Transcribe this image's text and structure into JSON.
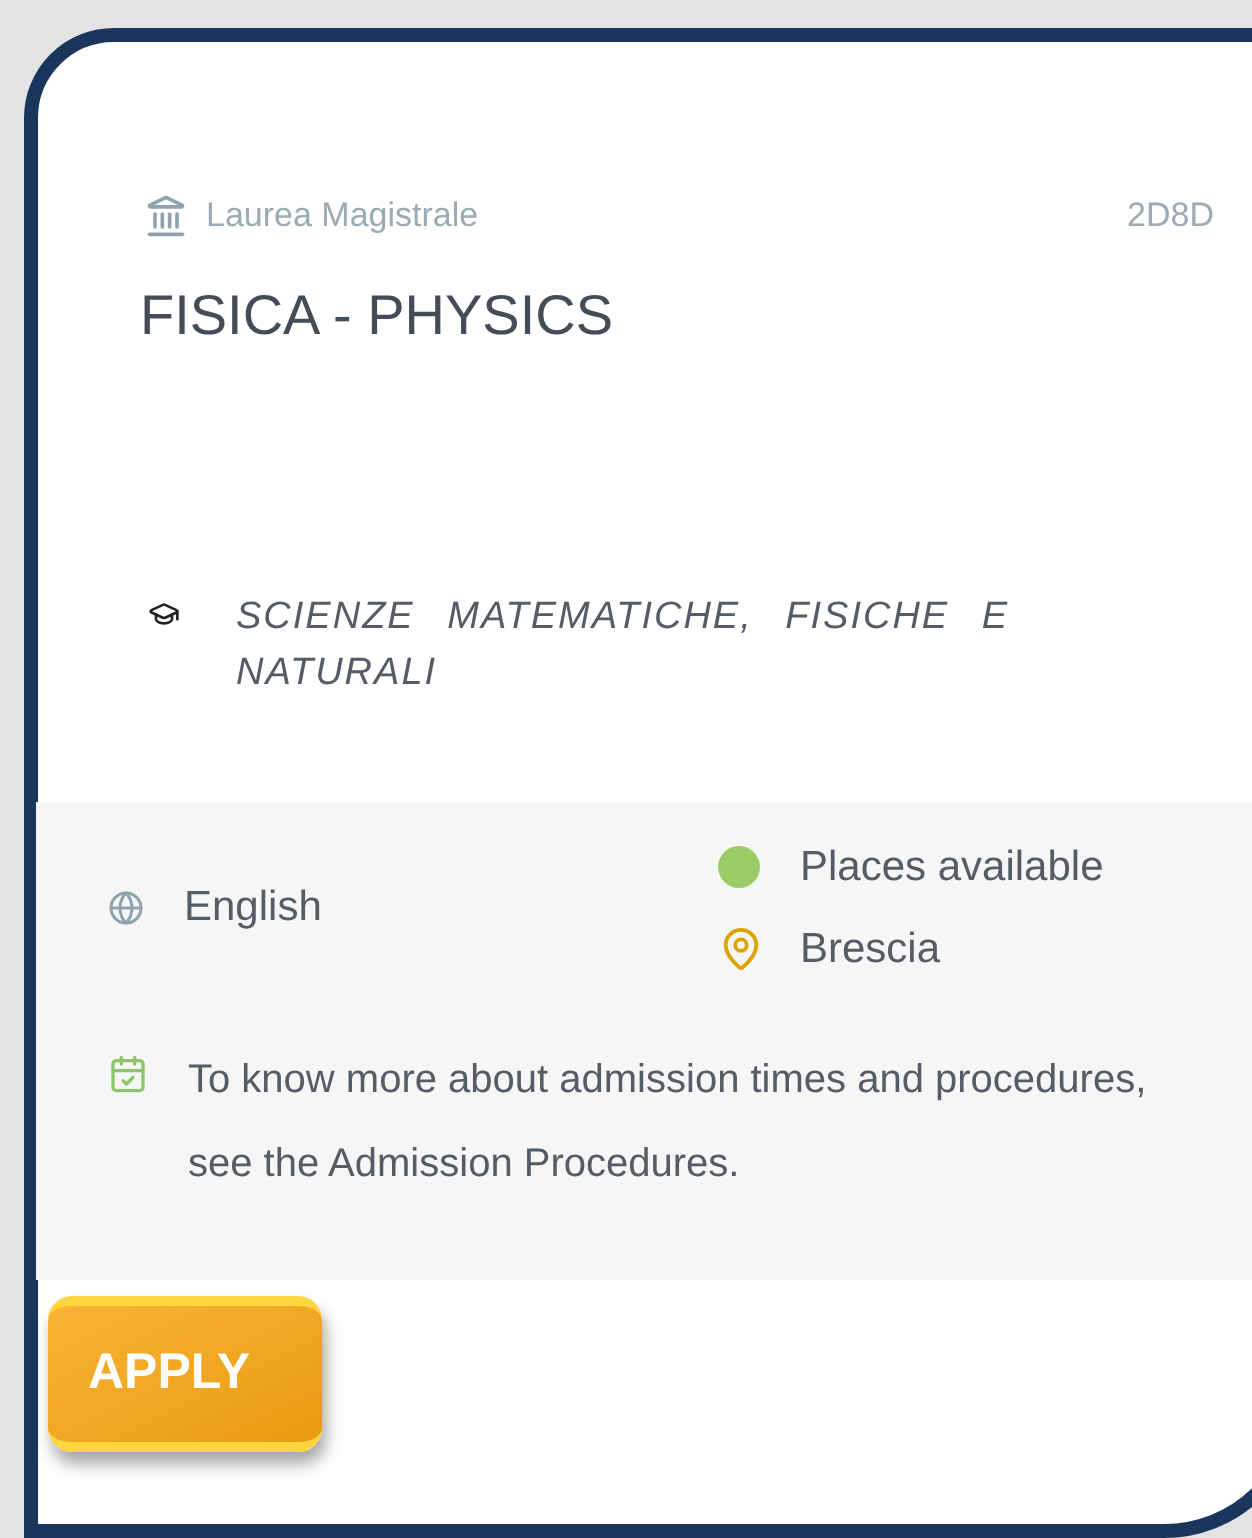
{
  "course": {
    "degree_type": "Laurea Magistrale",
    "code": "2D8D",
    "title": "FISICA - PHYSICS",
    "faculty": "SCIENZE MATEMATICHE, FISICHE E NATURALI"
  },
  "details": {
    "language": "English",
    "availability": {
      "label": "Places available",
      "color": "#99cc66"
    },
    "location": "Brescia",
    "note": "To know more about admission times and procedures, see the Admission Procedures."
  },
  "apply_button": {
    "label": "APPLY"
  }
}
